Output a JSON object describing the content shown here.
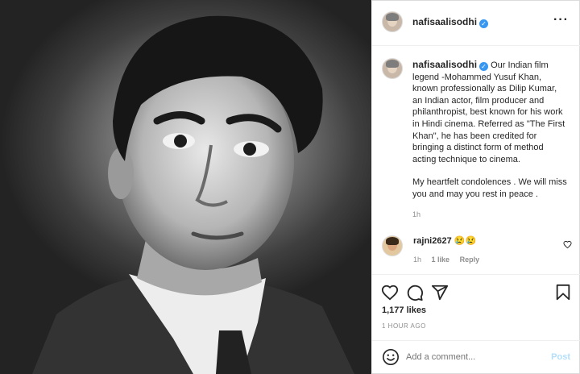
{
  "post": {
    "username": "nafisaalisodhi",
    "verified": true,
    "more_icon": "more-horizontal-icon"
  },
  "caption": {
    "username": "nafisaalisodhi",
    "text_1": "Our Indian film legend -Mohammed Yusuf Khan, known professionally as Dilip Kumar, an Indian actor, film producer and philanthropist, best known for his work in Hindi cinema. Referred as \"The First Khan\", he has been credited for bringing a distinct form of method acting technique to cinema.",
    "text_2": "My heartfelt condolences . We will miss you and may you rest in peace .",
    "time": "1h"
  },
  "comment": {
    "username": "rajni2627",
    "text": "😢😢",
    "time": "1h",
    "likes": "1 like",
    "reply": "Reply"
  },
  "actions": {
    "likes": "1,177 likes",
    "ago": "1 HOUR AGO"
  },
  "add_comment": {
    "placeholder": "Add a comment...",
    "post_label": "Post"
  },
  "colors": {
    "verified": "#3897f0",
    "post_disabled": "#b2dffc"
  }
}
